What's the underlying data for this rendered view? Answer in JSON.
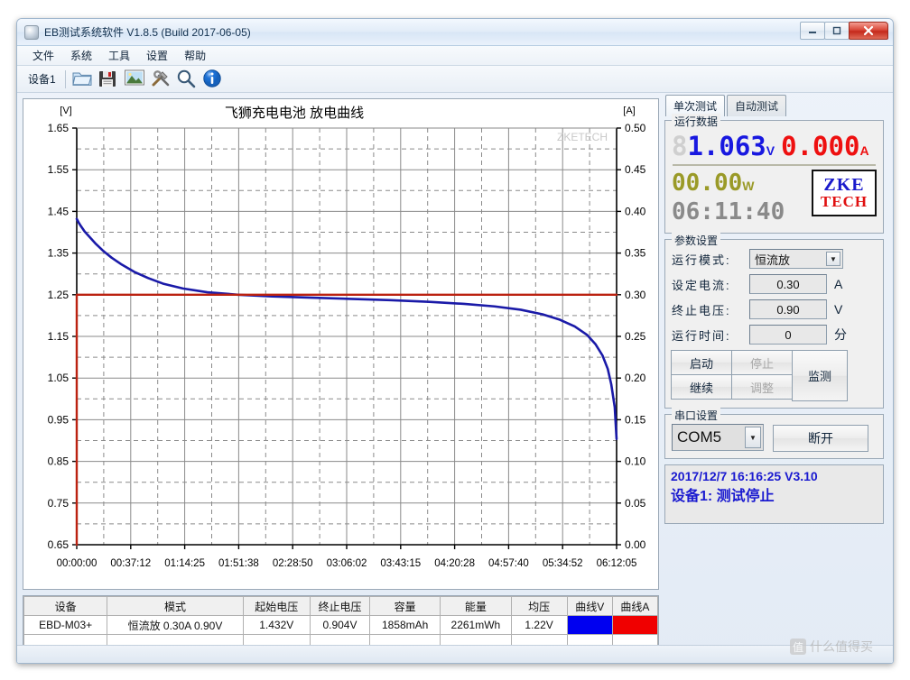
{
  "window": {
    "title": "EB测试系统软件 V1.8.5 (Build 2017-06-05)",
    "minimize": "—",
    "maximize": "❐",
    "close": "✕"
  },
  "menu": {
    "items": [
      "文件",
      "系统",
      "工具",
      "设置",
      "帮助"
    ]
  },
  "toolbar": {
    "device_tab": "设备1",
    "icons": [
      "open-folder-icon",
      "save-floppy-icon",
      "image-icon",
      "tools-icon",
      "magnifier-icon",
      "info-icon"
    ]
  },
  "right": {
    "tabs": [
      {
        "label": "单次测试",
        "active": true
      },
      {
        "label": "自动测试",
        "active": false
      }
    ],
    "run_data": {
      "legend": "运行数据",
      "voltage": "1.063",
      "voltage_pad": "8",
      "voltage_unit": "V",
      "current": "0.000",
      "current_unit": "A",
      "power": "00.00",
      "power_unit": "W",
      "time": "06:11:40",
      "logo_top": "ZKE",
      "logo_bottom": "TECH"
    },
    "params": {
      "legend": "参数设置",
      "mode_label": "运行模式:",
      "mode_value": "恒流放",
      "current_label": "设定电流:",
      "current_value": "0.30",
      "current_unit": "A",
      "cutoff_label": "终止电压:",
      "cutoff_value": "0.90",
      "cutoff_unit": "V",
      "runtime_label": "运行时间:",
      "runtime_value": "0",
      "runtime_unit": "分",
      "btn_start": "启动",
      "btn_stop": "停止",
      "btn_monitor": "监测",
      "btn_continue": "继续",
      "btn_adjust": "调整"
    },
    "serial": {
      "legend": "串口设置",
      "port": "COM5",
      "disconnect": "断开"
    },
    "status": {
      "line1": "2017/12/7 16:16:25  V3.10",
      "line2": "设备1: 测试停止"
    }
  },
  "chart_data": {
    "type": "line",
    "title": "飞狮充电电池 放电曲线",
    "watermark": "ZKETECH",
    "ylabel": "[V]",
    "y2label": "[A]",
    "xlabel": "",
    "ylim": [
      0.65,
      1.65
    ],
    "y2lim": [
      0.0,
      0.5
    ],
    "yticks": [
      "1.65",
      "1.55",
      "1.45",
      "1.35",
      "1.25",
      "1.15",
      "1.05",
      "0.95",
      "0.85",
      "0.75",
      "0.65"
    ],
    "y2ticks": [
      "0.50",
      "0.45",
      "0.40",
      "0.35",
      "0.30",
      "0.25",
      "0.20",
      "0.15",
      "0.10",
      "0.05",
      "0.00"
    ],
    "xticks": [
      "00:00:00",
      "00:37:12",
      "01:14:25",
      "01:51:38",
      "02:28:50",
      "03:06:02",
      "03:43:15",
      "04:20:28",
      "04:57:40",
      "05:34:52",
      "06:12:05"
    ],
    "grid": true,
    "legend_position": "none",
    "series": [
      {
        "name": "曲线V",
        "axis": "left",
        "color": "#1a1aa8",
        "x": [
          0,
          0.02,
          0.05,
          0.09,
          0.15,
          0.22,
          0.3,
          0.4,
          0.52,
          0.66,
          0.82,
          1.0,
          1.22,
          1.5,
          1.85,
          2.25,
          2.7,
          3.15,
          3.6,
          4.05,
          4.45,
          4.8,
          5.1,
          5.35,
          5.55,
          5.72,
          5.86,
          5.96,
          6.04,
          6.1,
          6.14,
          6.18,
          6.201
        ],
        "y": [
          1.432,
          1.424,
          1.414,
          1.402,
          1.388,
          1.372,
          1.356,
          1.339,
          1.322,
          1.305,
          1.29,
          1.276,
          1.265,
          1.256,
          1.25,
          1.246,
          1.243,
          1.24,
          1.237,
          1.233,
          1.228,
          1.222,
          1.214,
          1.203,
          1.19,
          1.174,
          1.154,
          1.131,
          1.104,
          1.072,
          1.035,
          0.98,
          0.904
        ]
      },
      {
        "name": "曲线A",
        "axis": "right",
        "color": "#bb2211",
        "x": [
          0,
          0,
          6.201
        ],
        "y": [
          0.0,
          0.3,
          0.3
        ]
      }
    ]
  },
  "table": {
    "headers": [
      "设备",
      "模式",
      "起始电压",
      "终止电压",
      "容量",
      "能量",
      "均压",
      "曲线V",
      "曲线A"
    ],
    "rows": [
      {
        "device": "EBD-M03+",
        "mode": "恒流放  0.30A  0.90V",
        "start_voltage": "1.432V",
        "end_voltage": "0.904V",
        "capacity": "1858mAh",
        "energy": "2261mWh",
        "avg_voltage": "1.22V",
        "curve_v_color": "#0000f0",
        "curve_a_color": "#f00000"
      }
    ]
  },
  "watermark_bottom": {
    "badge": "值",
    "text": "什么值得买"
  }
}
